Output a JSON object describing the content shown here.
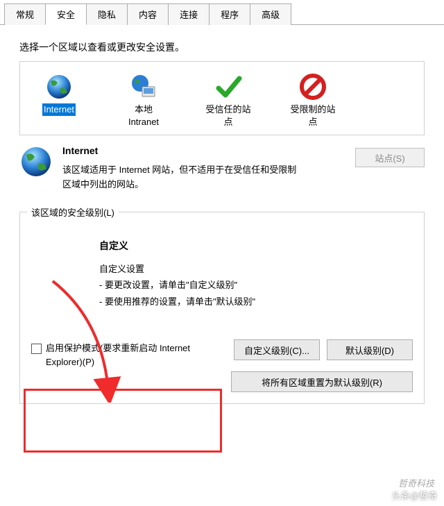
{
  "tabs": [
    "常规",
    "安全",
    "隐私",
    "内容",
    "连接",
    "程序",
    "高级"
  ],
  "activeTab": 1,
  "prompt": "选择一个区域以查看或更改安全设置。",
  "zones": [
    {
      "label": "Internet",
      "type": "globe",
      "selected": true
    },
    {
      "label": "本地\nIntranet",
      "type": "intranet",
      "selected": false
    },
    {
      "label": "受信任的站\n点",
      "type": "trusted",
      "selected": false
    },
    {
      "label": "受限制的站\n点",
      "type": "restricted",
      "selected": false
    }
  ],
  "zoneDetail": {
    "title": "Internet",
    "desc": "该区域适用于 Internet 网站，但不适用于在受信任和受限制区域中列出的网站。",
    "sitesBtn": "站点(S)"
  },
  "security": {
    "legend": "该区域的安全级别(L)",
    "customTitle": "自定义",
    "customSub": "自定义设置",
    "line1": "- 要更改设置，请单击\"自定义级别\"",
    "line2": "- 要使用推荐的设置，请单击\"默认级别\"",
    "protectLabel": "启用保护模式(要求重新启动 Internet Explorer)(P)",
    "customLevelBtn": "自定义级别(C)...",
    "defaultLevelBtn": "默认级别(D)",
    "resetAllBtn": "将所有区域重置为默认级别(R)"
  },
  "watermark": "头条@哲奇",
  "watermark2": "哲奇科技"
}
